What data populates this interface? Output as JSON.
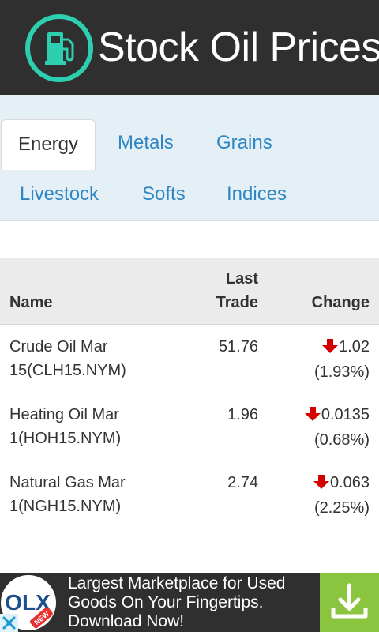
{
  "header": {
    "title": "Stock Oil Prices",
    "logo_icon": "fuel-pump-icon"
  },
  "tabs": [
    {
      "label": "Energy",
      "active": true
    },
    {
      "label": "Metals",
      "active": false
    },
    {
      "label": "Grains",
      "active": false
    },
    {
      "label": "Livestock",
      "active": false
    },
    {
      "label": "Softs",
      "active": false
    },
    {
      "label": "Indices",
      "active": false
    }
  ],
  "table": {
    "headers": {
      "name": "Name",
      "last_trade_line1": "Last",
      "last_trade_line2": "Trade",
      "change": "Change"
    },
    "rows": [
      {
        "name_line1": "Crude Oil Mar",
        "name_line2": "15(CLH15.NYM)",
        "last_trade": "51.76",
        "change": "1.02",
        "change_pct": "(1.93%)",
        "direction": "down"
      },
      {
        "name_line1": "Heating Oil Mar",
        "name_line2": "1(HOH15.NYM)",
        "last_trade": "1.96",
        "change": "0.0135",
        "change_pct": "(0.68%)",
        "direction": "down"
      },
      {
        "name_line1": "Natural Gas Mar",
        "name_line2": "1(NGH15.NYM)",
        "last_trade": "2.74",
        "change": "0.063",
        "change_pct": "(2.25%)",
        "direction": "down"
      }
    ]
  },
  "ad": {
    "line1": "Largest Marketplace for Used",
    "line2": "Goods On Your Fingertips.",
    "line3": "Download Now!",
    "brand": "OLX",
    "brand_badge": "NEW",
    "download_icon": "download-icon",
    "close_icon": "close-icon"
  },
  "colors": {
    "header_bg": "#2f2f2f",
    "logo_ring": "#2ecfb0",
    "tab_link": "#2f86c4",
    "tabs_bg": "#e4f0f6",
    "down_arrow": "#d40000",
    "ad_download_bg": "#8bc53f"
  }
}
